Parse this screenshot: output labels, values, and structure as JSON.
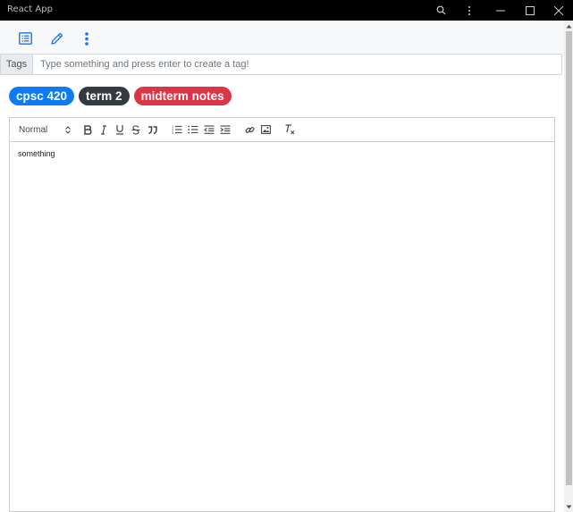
{
  "window": {
    "title": "React App",
    "controls": [
      "zoom-icon",
      "more-vert-icon",
      "minimize-icon",
      "maximize-icon",
      "close-icon"
    ]
  },
  "top_toolbar": {
    "icons": [
      "list-view-icon",
      "edit-pencil-icon",
      "more-options-icon"
    ],
    "accent": "#1a73e8"
  },
  "tags": {
    "label": "Tags",
    "placeholder": "Type something and press enter to create a tag!",
    "value": "",
    "badges": [
      {
        "text": "cpsc 420",
        "color": "#0d7bf5"
      },
      {
        "text": "term 2",
        "color": "#343a40"
      },
      {
        "text": "midterm notes",
        "color": "#dc3545"
      }
    ]
  },
  "editor": {
    "header_select": "Normal",
    "toolbar_buttons": [
      "bold-icon",
      "italic-icon",
      "underline-icon",
      "strike-icon",
      "blockquote-icon",
      "ordered-list-icon",
      "bullet-list-icon",
      "outdent-icon",
      "indent-icon",
      "link-icon",
      "image-icon",
      "clear-format-icon"
    ],
    "content": "something"
  }
}
